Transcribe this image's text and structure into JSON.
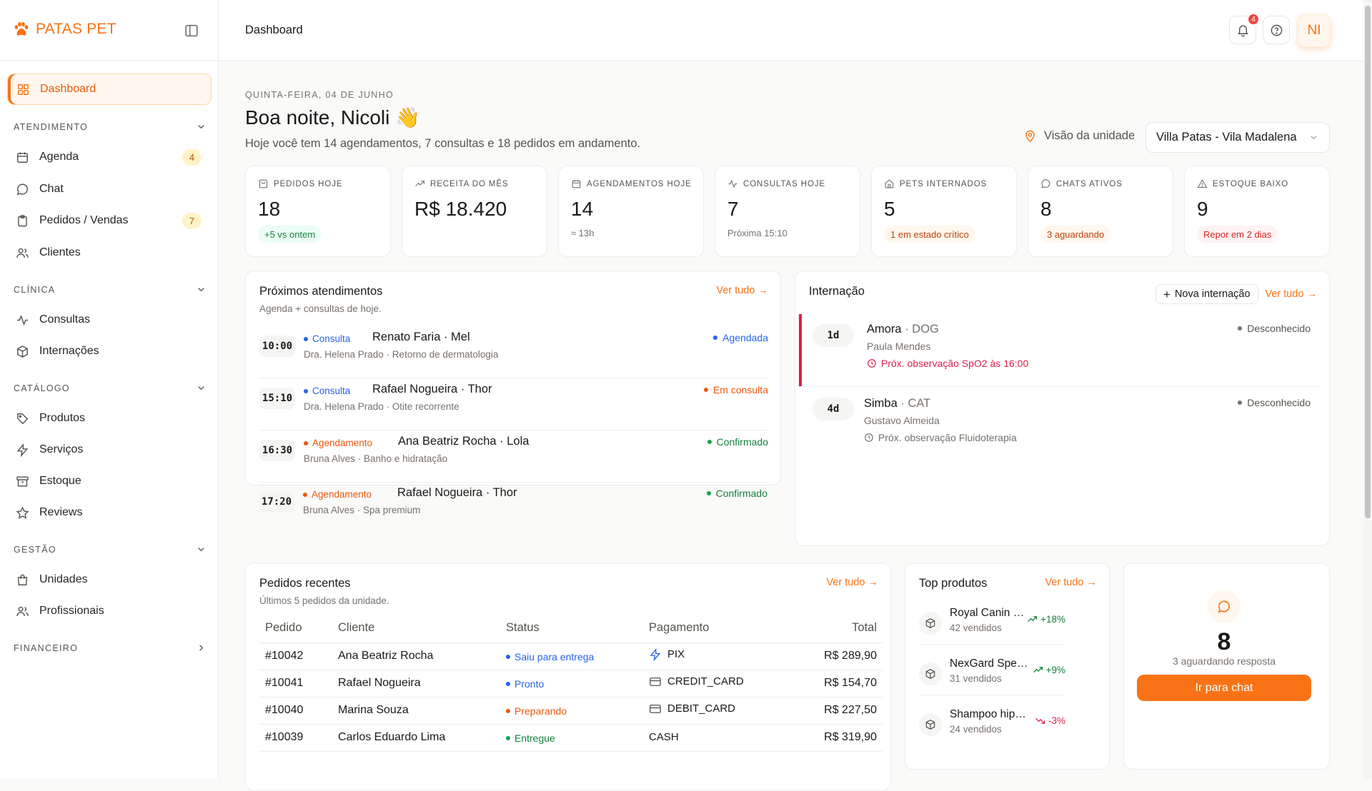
{
  "brand": {
    "name": "PATAS PET",
    "color": "#f97316"
  },
  "sidebar": {
    "dashboard": {
      "label": "Dashboard",
      "icon": "layout-grid-icon"
    },
    "sections": [
      {
        "title": "ATENDIMENTO",
        "items": [
          {
            "label": "Agenda",
            "icon": "calendar-icon",
            "badge": "4"
          },
          {
            "label": "Chat",
            "icon": "message-circle-icon"
          },
          {
            "label": "Pedidos / Vendas",
            "icon": "clipboard-icon",
            "badge": "7"
          },
          {
            "label": "Clientes",
            "icon": "users-icon"
          }
        ]
      },
      {
        "title": "CLÍNICA",
        "items": [
          {
            "label": "Consultas",
            "icon": "activity-icon"
          },
          {
            "label": "Internações",
            "icon": "box-icon"
          }
        ]
      },
      {
        "title": "CATÁLOGO",
        "items": [
          {
            "label": "Produtos",
            "icon": "tag-icon"
          },
          {
            "label": "Serviços",
            "icon": "zap-icon"
          },
          {
            "label": "Estoque",
            "icon": "archive-icon"
          },
          {
            "label": "Reviews",
            "icon": "star-icon"
          }
        ]
      },
      {
        "title": "GESTÃO",
        "items": [
          {
            "label": "Unidades",
            "icon": "store-icon"
          },
          {
            "label": "Profissionais",
            "icon": "users-icon"
          }
        ]
      },
      {
        "title": "FINANCEIRO",
        "items": []
      }
    ]
  },
  "topbar": {
    "title": "Dashboard",
    "notifications": "4",
    "avatar_initials": "NI"
  },
  "header": {
    "date": "QUINTA-FEIRA, 04 DE JUNHO",
    "greeting": "Boa noite, Nicoli 👋",
    "summary": "Hoje você tem 14 agendamentos, 7 consultas e 18 pedidos em andamento.",
    "unit_label": "Visão da unidade",
    "unit_value": "Villa Patas - Vila Madalena"
  },
  "stats": [
    {
      "label": "PEDIDOS HOJE",
      "icon": "shopping-bag-icon",
      "value": "18",
      "pill": "+5 vs ontem",
      "pill_color": "green"
    },
    {
      "label": "RECEITA DO MÊS",
      "icon": "trending-up-icon",
      "value": "R$ 18.420"
    },
    {
      "label": "AGENDAMENTOS HOJE",
      "icon": "calendar-icon",
      "value": "14",
      "sub": "≈ 13h"
    },
    {
      "label": "CONSULTAS HOJE",
      "icon": "activity-icon",
      "value": "7",
      "sub": "Próxima 15:10"
    },
    {
      "label": "PETS INTERNADOS",
      "icon": "home-icon",
      "value": "5",
      "pill": "1 em estado crítico",
      "pill_color": "orange"
    },
    {
      "label": "CHATS ATIVOS",
      "icon": "message-circle-icon",
      "value": "8",
      "pill": "3 aguardando",
      "pill_color": "orange"
    },
    {
      "label": "ESTOQUE BAIXO",
      "icon": "alert-triangle-icon",
      "value": "9",
      "pill": "Repor em 2 dias",
      "pill_color": "red"
    }
  ],
  "appointments": {
    "title": "Próximos atendimentos",
    "subtitle": "Agenda + consultas de hoje.",
    "see_all": "Ver tudo →",
    "items": [
      {
        "time": "10:00",
        "type": "Consulta",
        "name": "Renato Faria · Mel",
        "detail": "Dra. Helena Prado · Retorno de dermatologia",
        "status": "Agendada"
      },
      {
        "time": "15:10",
        "type": "Consulta",
        "name": "Rafael Nogueira · Thor",
        "detail": "Dra. Helena Prado · Otite recorrente",
        "status": "Em consulta"
      },
      {
        "time": "16:30",
        "type": "Agendamento",
        "name": "Ana Beatriz Rocha · Lola",
        "detail": "Bruna Alves · Banho e hidratação",
        "status": "Confirmado"
      },
      {
        "time": "17:20",
        "type": "Agendamento",
        "name": "Rafael Nogueira · Thor",
        "detail": "Bruna Alves · Spa premium",
        "status": "Confirmado"
      }
    ]
  },
  "hospitalization": {
    "title": "Internação",
    "new_button": "Nova internação",
    "see_all": "Ver tudo →",
    "items": [
      {
        "days": "1d",
        "name": "Amora",
        "species": " · DOG",
        "owner": "Paula Mendes",
        "obs": "Próx. observação SpO2 às 16:00",
        "status": "Desconhecido"
      },
      {
        "days": "4d",
        "name": "Simba",
        "species": " · CAT",
        "owner": "Gustavo Almeida",
        "obs": "Próx. observação Fluidoterapia",
        "status": "Desconhecido"
      }
    ]
  },
  "orders": {
    "title": "Pedidos recentes",
    "subtitle": "Últimos 5 pedidos da unidade.",
    "see_all": "Ver tudo →",
    "columns": [
      "Pedido",
      "Cliente",
      "Status",
      "Pagamento",
      "Total"
    ],
    "rows": [
      {
        "id": "#10042",
        "client": "Ana Beatriz Rocha",
        "status": "Saiu para entrega",
        "payment": "PIX",
        "total": "R$ 289,90"
      },
      {
        "id": "#10041",
        "client": "Rafael Nogueira",
        "status": "Pronto",
        "payment": "CREDIT_CARD",
        "total": "R$ 154,70"
      },
      {
        "id": "#10040",
        "client": "Marina Souza",
        "status": "Preparando",
        "payment": "DEBIT_CARD",
        "total": "R$ 227,50"
      },
      {
        "id": "#10039",
        "client": "Carlos Eduardo Lima",
        "status": "Entregue",
        "payment": "CASH",
        "total": "R$ 319,90"
      }
    ]
  },
  "top_products": {
    "title": "Top produtos",
    "see_all": "Ver tudo →",
    "items": [
      {
        "name": "Royal Canin Ga...",
        "sold": "42 vendidos",
        "trend": "+18%"
      },
      {
        "name": "NexGard Spectra",
        "sold": "31 vendidos",
        "trend": "+9%"
      },
      {
        "name": "Shampoo hipoal...",
        "sold": "24 vendidos",
        "trend": "-3%"
      }
    ]
  },
  "chat_widget": {
    "count": "8",
    "subtitle": "3 aguardando resposta",
    "button": "Ir para chat"
  }
}
